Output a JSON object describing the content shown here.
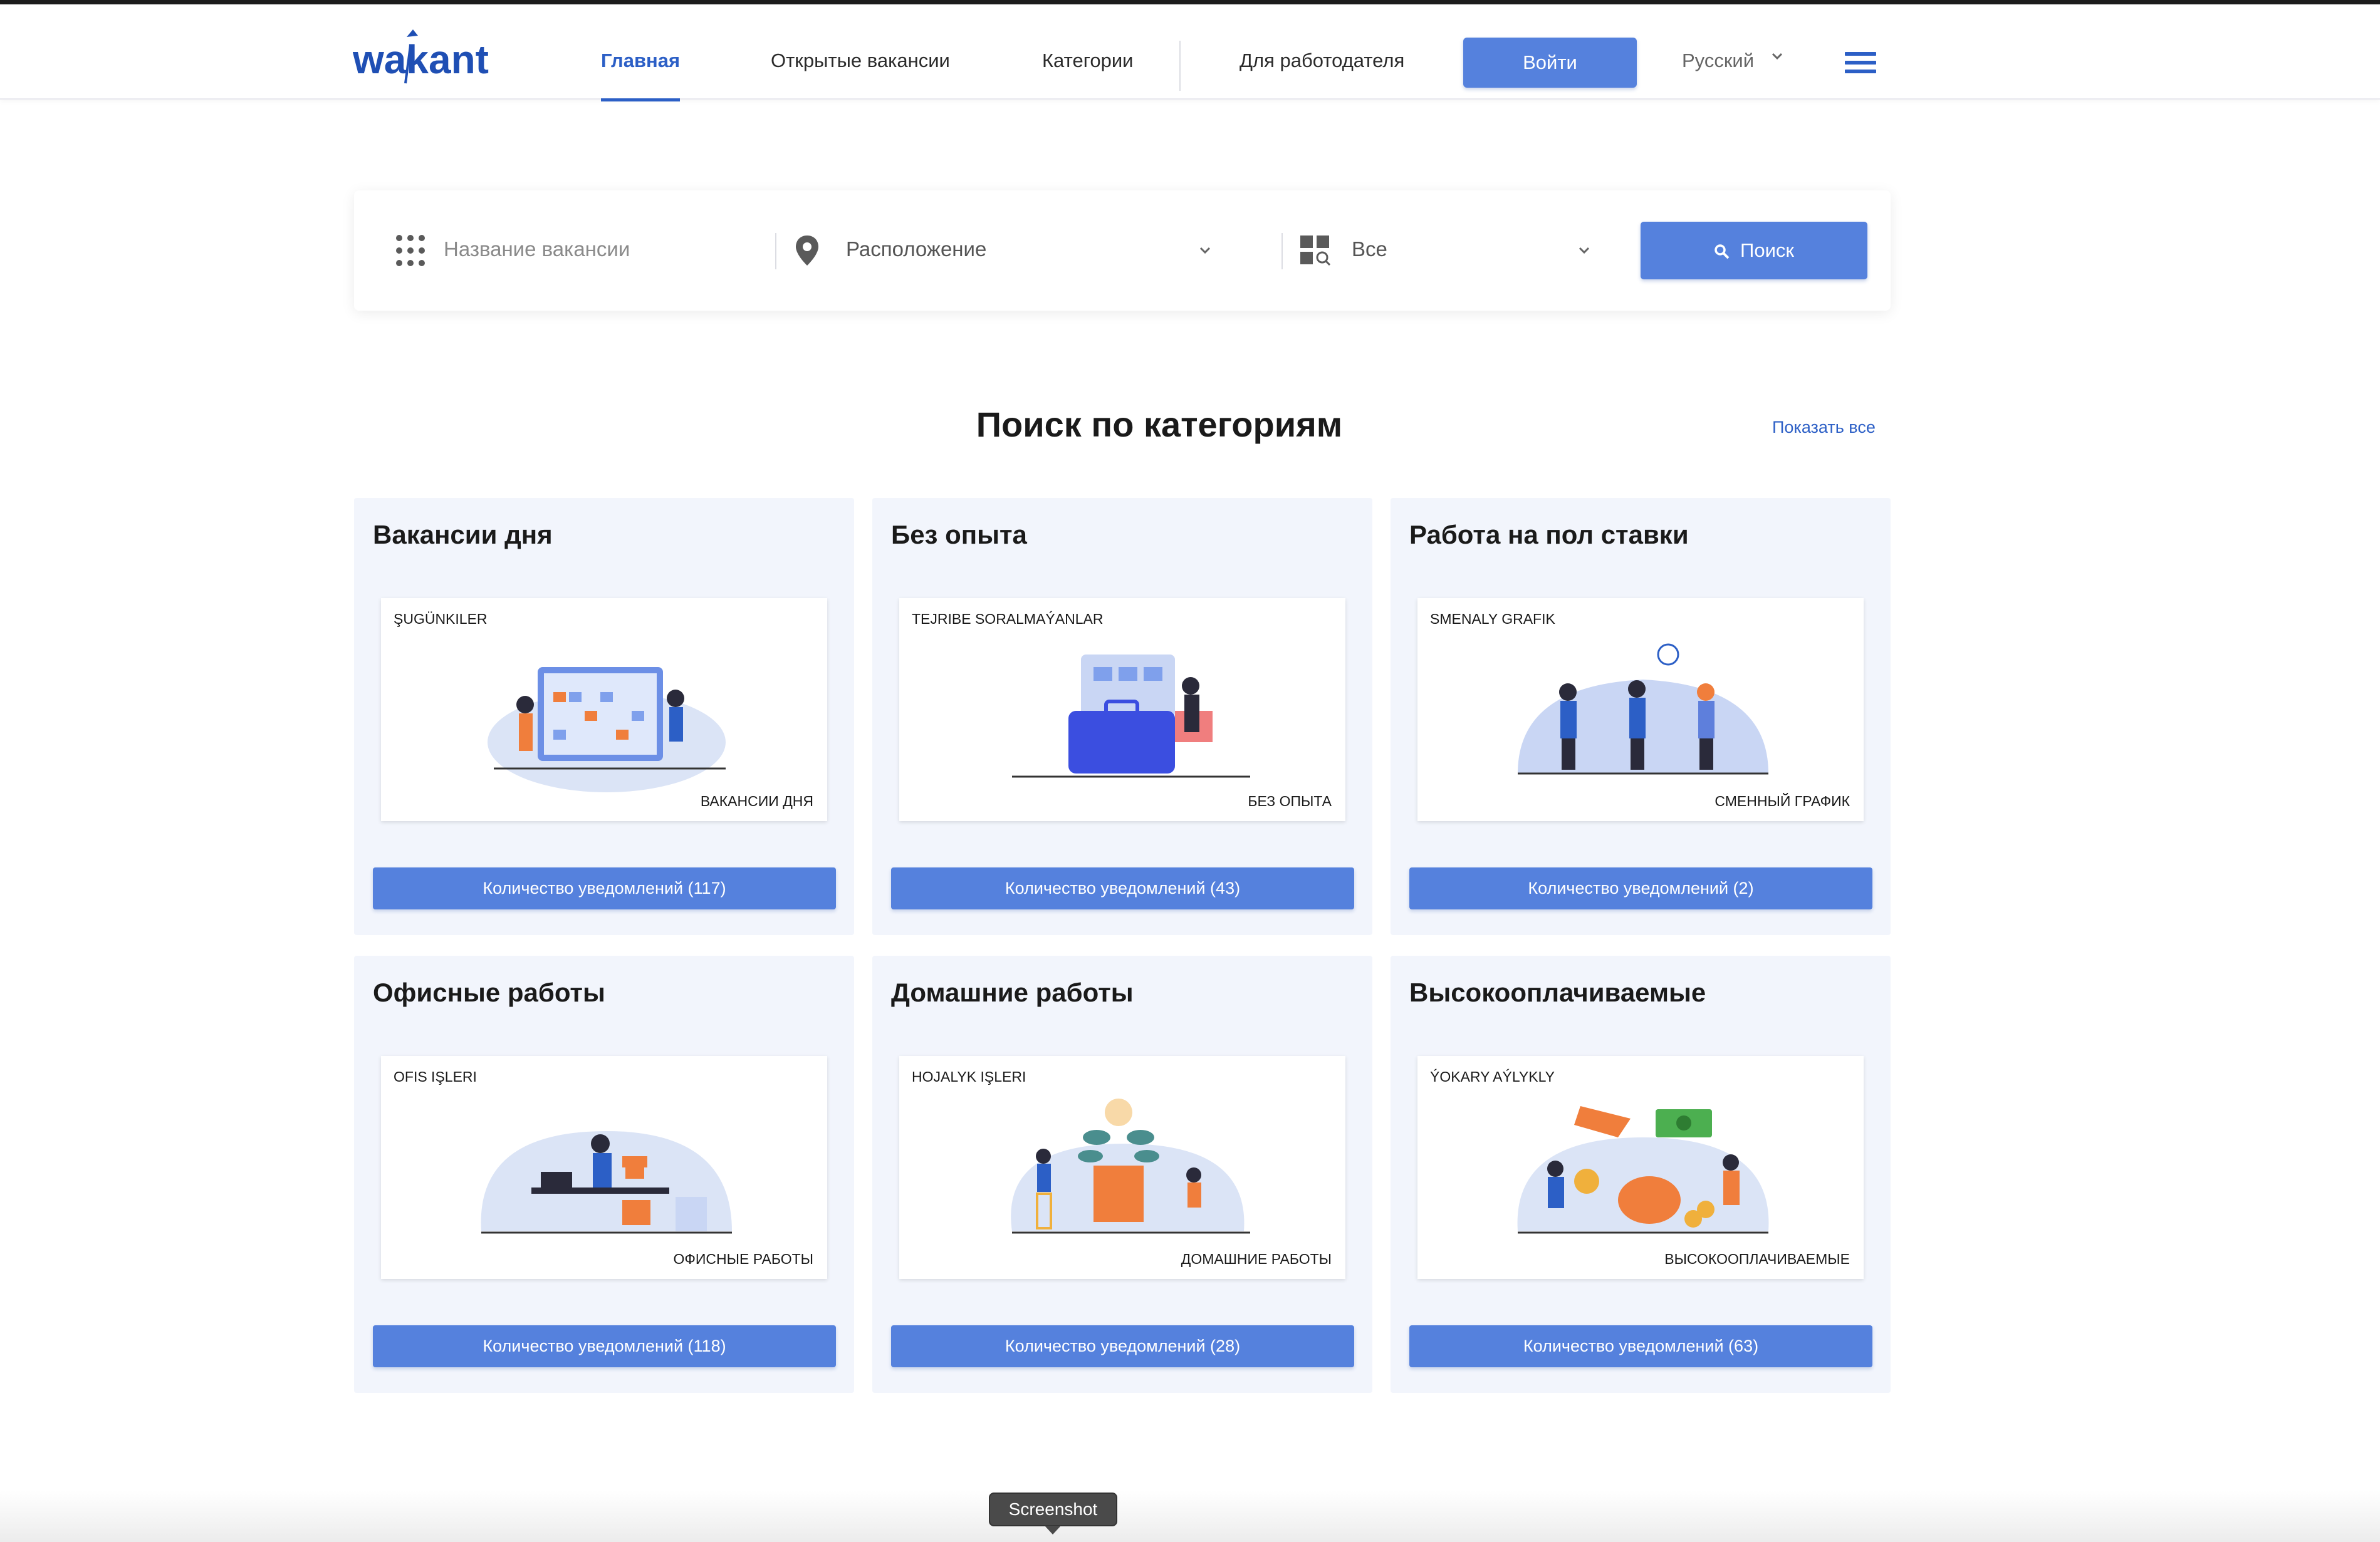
{
  "header": {
    "logo_text": "wakant",
    "nav": [
      {
        "label": "Главная",
        "active": true
      },
      {
        "label": "Открытые вакансии"
      },
      {
        "label": "Категории"
      },
      {
        "label": "Для работодателя"
      }
    ],
    "login_label": "Войти",
    "language": "Русский"
  },
  "search": {
    "title_placeholder": "Название вакансии",
    "location_label": "Расположение",
    "category_label": "Все",
    "button_label": "Поиск"
  },
  "section": {
    "title": "Поиск по категориям",
    "show_all": "Показать все"
  },
  "cards": [
    {
      "title": "Вакансии дня",
      "img_top": "ŞUGÜNKILER",
      "img_bottom": "ВАКАНСИИ ДНЯ",
      "button": "Количество уведомлений (117)"
    },
    {
      "title": "Без опыта",
      "img_top": "TEJRIBE SORALMAÝANLAR",
      "img_bottom": "БЕЗ ОПЫТА",
      "button": "Количество уведомлений (43)"
    },
    {
      "title": "Работа на пол ставки",
      "img_top": "SMENALY GRAFIK",
      "img_bottom": "СМЕННЫЙ ГРАФИК",
      "button": "Количество уведомлений (2)"
    },
    {
      "title": "Офисные работы",
      "img_top": "OFIS IŞLERI",
      "img_bottom": "ОФИСНЫЕ РАБОТЫ",
      "button": "Количество уведомлений (118)"
    },
    {
      "title": "Домашние работы",
      "img_top": "HOJALYK IŞLERI",
      "img_bottom": "ДОМАШНИЕ РАБОТЫ",
      "button": "Количество уведомлений (28)"
    },
    {
      "title": "Высокооплачиваемые",
      "img_top": "ÝOKARY AÝLYKLY",
      "img_bottom": "ВЫСОКООПЛАЧИВАЕМЫЕ",
      "button": "Количество уведомлений (63)"
    }
  ],
  "tooltip": "Screenshot",
  "colors": {
    "accent": "#5581dd",
    "link": "#2c5fc6",
    "card_bg": "#f2f5fc"
  }
}
